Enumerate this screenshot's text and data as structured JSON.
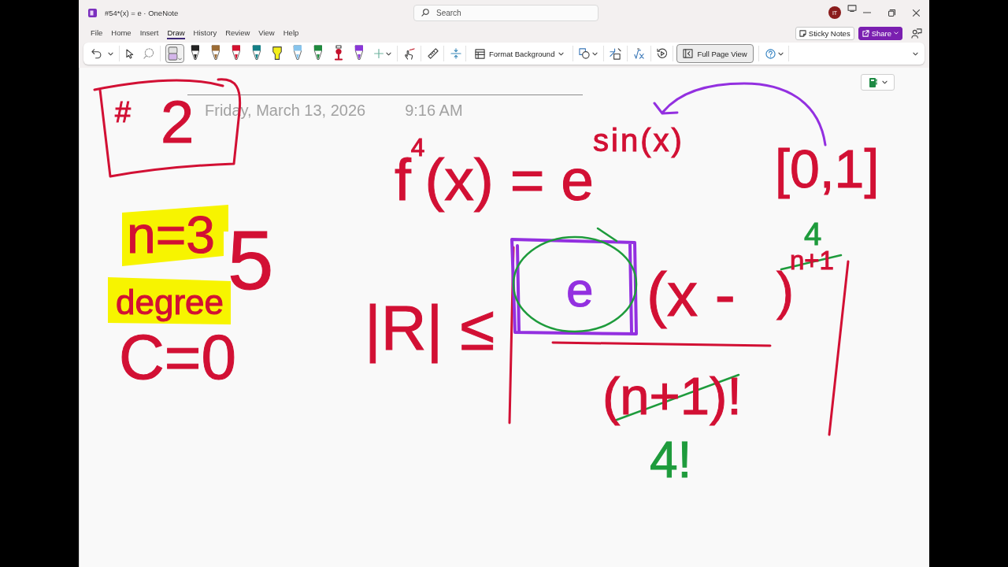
{
  "window": {
    "title": "#54*(x) = e · OneNote",
    "search": {
      "placeholder": "Search"
    },
    "account": {
      "initials": "IT"
    }
  },
  "menu_tabs": [
    {
      "label": "File",
      "selected": false
    },
    {
      "label": "Home",
      "selected": false
    },
    {
      "label": "Insert",
      "selected": false
    },
    {
      "label": "Draw",
      "selected": true
    },
    {
      "label": "History",
      "selected": false
    },
    {
      "label": "Review",
      "selected": false
    },
    {
      "label": "View",
      "selected": false
    },
    {
      "label": "Help",
      "selected": false
    }
  ],
  "header_buttons": [
    {
      "label": "Sticky Notes",
      "kind": "outline"
    },
    {
      "label": "Share",
      "kind": "primary"
    }
  ],
  "ribbon": {
    "ink_tools": [
      {
        "kind": "eraser",
        "selected": true
      },
      {
        "kind": "pen",
        "color": "#222222",
        "selected": false
      },
      {
        "kind": "pen",
        "color": "#9b6b34",
        "selected": false
      },
      {
        "kind": "pen",
        "color": "#d4112f",
        "selected": false
      },
      {
        "kind": "pen",
        "color": "#137f86",
        "selected": false
      },
      {
        "kind": "highlighter",
        "color": "#f4ef1c",
        "selected": false
      },
      {
        "kind": "pen",
        "color": "#86c4ec",
        "selected": false
      },
      {
        "kind": "pen",
        "color": "#1f8a3e",
        "selected": false
      },
      {
        "kind": "marker",
        "color": "#c4102c",
        "selected": false
      },
      {
        "kind": "pen",
        "color": "#8a36d8",
        "selected": false
      }
    ],
    "format_background": {
      "label": "Format Background"
    },
    "full_page_view": {
      "label": "Full Page View",
      "on": true
    }
  },
  "page": {
    "date": "Friday, March 13, 2026",
    "time": "9:16 AM",
    "ink": [
      {
        "kind": "stroke",
        "color": "#d21034"
      },
      {
        "kind": "text",
        "text": "#",
        "color": "#d21034"
      },
      {
        "kind": "text",
        "text": "2",
        "color": "#d21034"
      },
      {
        "kind": "text",
        "text": "f$^{4}$(x) = e",
        "color": "#d21034"
      },
      {
        "kind": "text",
        "text": "sin(x)",
        "color": "#d21034"
      },
      {
        "kind": "stroke",
        "color": "#9330e0"
      },
      {
        "kind": "text",
        "text": "[0,1]",
        "color": "#d21034"
      },
      {
        "kind": "highlight",
        "color": "#f7f400"
      },
      {
        "kind": "text",
        "text": "n=3",
        "color": "#d21034"
      },
      {
        "kind": "text",
        "text": "5",
        "color": "#d21034"
      },
      {
        "kind": "highlight",
        "color": "#f7f400"
      },
      {
        "kind": "text",
        "text": "degree",
        "color": "#d21034"
      },
      {
        "kind": "text",
        "text": "C=0",
        "color": "#d21034"
      },
      {
        "kind": "text",
        "text": "|R| ≤",
        "color": "#d21034"
      },
      {
        "kind": "stroke",
        "color": "#d21034"
      },
      {
        "kind": "stroke",
        "color": "#9330e0"
      },
      {
        "kind": "stroke",
        "color": "#1e9b3c"
      },
      {
        "kind": "text",
        "text": "e",
        "color": "#9330e0"
      },
      {
        "kind": "text",
        "text": "(x -",
        "color": "#d21034"
      },
      {
        "kind": "text",
        "text": ")",
        "color": "#d21034"
      },
      {
        "kind": "text",
        "text": "4",
        "color": "#1e9b3c"
      },
      {
        "kind": "text",
        "text": "n+1",
        "color": "#d21034"
      },
      {
        "kind": "stroke",
        "color": "#1e9b3c"
      },
      {
        "kind": "stroke",
        "color": "#d21034"
      },
      {
        "kind": "stroke",
        "color": "#d21034"
      },
      {
        "kind": "text",
        "text": "(n+1)!",
        "color": "#d21034"
      },
      {
        "kind": "stroke",
        "color": "#1e9b3c"
      },
      {
        "kind": "text",
        "text": "4!",
        "color": "#1e9b3c"
      }
    ]
  }
}
